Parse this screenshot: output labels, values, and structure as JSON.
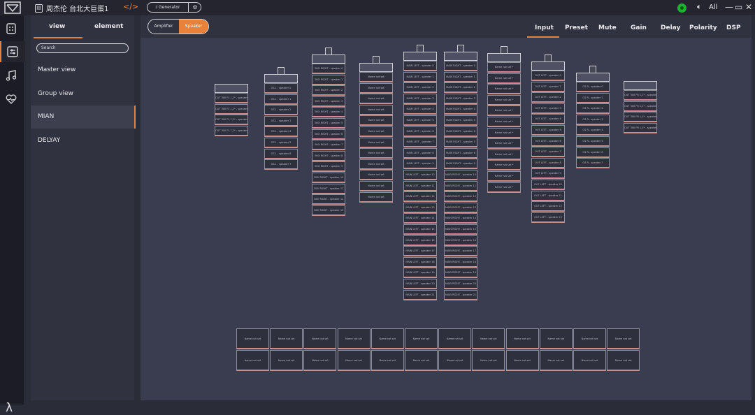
{
  "titlebar": {
    "project_title": "周杰伦 台北大巨蛋1",
    "project_icon": "save-icon",
    "nav_arrows": "</>",
    "generator_label": "Generator",
    "status_color": "#1fb32f",
    "volume_label": "All",
    "minimize": "—",
    "maximize": "▭",
    "close": "✕"
  },
  "rail": [
    "grid-icon",
    "mixer-icon",
    "music-icon",
    "heartbeat-icon"
  ],
  "sidebar": {
    "tabs": [
      "view",
      "element"
    ],
    "search_placeholder": "Search",
    "items": [
      "Master view",
      "Group view",
      "MIAN",
      "DELYAY"
    ],
    "selected": "MIAN"
  },
  "main": {
    "toggle": [
      "Amplifier",
      "Speaker"
    ],
    "active_toggle": "Speaker",
    "tabs": [
      "Input",
      "Preset",
      "Mute",
      "Gain",
      "Delay",
      "Polarity",
      "DSP"
    ],
    "active_tab": "Input",
    "columns": [
      {
        "cells": [
          "OUT 300 FL 1,1* - speaker",
          "OUT 300 FL 1,1* - speaker",
          "OUT 300 FL 1,1* - speaker",
          "OUT 300 FL 1,1* - speaker"
        ]
      },
      {
        "cells": [
          "OS L - speaker 0",
          "OS L - speaker 1",
          "OS L - speaker 2",
          "OS L - speaker 3",
          "OS L - speaker 4",
          "OS L - speaker 5",
          "OS L - speaker 6",
          "OS L - speaker 7"
        ]
      },
      {
        "cells": [
          "300I RIGHT - speaker 0",
          "300I RIGHT - speaker 1",
          "300I RIGHT - speaker 2",
          "300I RIGHT - speaker 3",
          "300I RIGHT - speaker 4",
          "300I RIGHT - speaker 5",
          "300I RIGHT - speaker 6",
          "300I RIGHT - speaker 7",
          "300I RIGHT - speaker 8",
          "300I RIGHT - speaker 9",
          "300I RIGHT - speaker 10",
          "300I RIGHT - speaker 11",
          "300I RIGHT - speaker 12",
          "300I RIGHT - speaker 13"
        ]
      },
      {
        "cells": [
          "Name not set",
          "Name not set",
          "Name not set",
          "Name not set",
          "Name not set",
          "Name not set",
          "Name not set",
          "Name not set",
          "Name not set",
          "Name not set",
          "Name not set",
          "Name not set"
        ]
      },
      {
        "cells": [
          "MAIN LEFT - speaker 0",
          "MAIN LEFT - speaker 1",
          "MAIN LEFT - speaker 2",
          "MAIN LEFT - speaker 3",
          "MAIN LEFT - speaker 4",
          "MAIN LEFT - speaker 5",
          "MAIN LEFT - speaker 6",
          "MAIN LEFT - speaker 7",
          "MAIN LEFT - speaker 8",
          "MAIN LEFT - speaker 9",
          "MAIN LEFT - speaker 10",
          "MAIN LEFT - speaker 11",
          "MAIN LEFT - speaker 12",
          "MAIN LEFT - speaker 13",
          "MAIN LEFT - speaker 14",
          "MAIN LEFT - speaker 15",
          "MAIN LEFT - speaker 16",
          "MAIN LEFT - speaker 17",
          "MAIN LEFT - speaker 18",
          "MAIN LEFT - speaker 19",
          "MAIN LEFT - speaker 20",
          "MAIN LEFT - speaker 21"
        ]
      },
      {
        "cells": [
          "MAIN RIGHT - speaker 0",
          "MAIN RIGHT - speaker 1",
          "MAIN RIGHT - speaker 2",
          "MAIN RIGHT - speaker 3",
          "MAIN RIGHT - speaker 4",
          "MAIN RIGHT - speaker 5",
          "MAIN RIGHT - speaker 6",
          "MAIN RIGHT - speaker 7",
          "MAIN RIGHT - speaker 8",
          "MAIN RIGHT - speaker 9",
          "MAIN RIGHT - speaker 10",
          "MAIN RIGHT - speaker 11",
          "MAIN RIGHT - speaker 12",
          "MAIN RIGHT - speaker 13",
          "MAIN RIGHT - speaker 14",
          "MAIN RIGHT - speaker 15",
          "MAIN RIGHT - speaker 16",
          "MAIN RIGHT - speaker 17",
          "MAIN RIGHT - speaker 18",
          "MAIN RIGHT - speaker 19",
          "MAIN RIGHT - speaker 20",
          "MAIN RIGHT - speaker 21"
        ]
      },
      {
        "cells": [
          "Name not set *",
          "Name not set *",
          "Name not set *",
          "Name not set *",
          "Name not set *",
          "Name not set *",
          "Name not set *",
          "Name not set *",
          "Name not set *",
          "Name not set *",
          "Name not set *",
          "Name not set *"
        ]
      },
      {
        "cells": [
          "OUT LEFT - speaker 0",
          "OUT LEFT - speaker 1",
          "OUT LEFT - speaker 2",
          "OUT LEFT - speaker 3",
          "OUT LEFT - speaker 4",
          "OUT LEFT - speaker 5",
          "OUT LEFT - speaker 6",
          "OUT LEFT - speaker 7",
          "OUT LEFT - speaker 8",
          "OUT LEFT - speaker 9",
          "OUT LEFT - speaker 10",
          "OUT LEFT - speaker 11",
          "OUT LEFT - speaker 12",
          "OUT LEFT - speaker 13"
        ]
      },
      {
        "cells": [
          "OS R - speaker 0",
          "OS R - speaker 1",
          "OS R - speaker 2",
          "OS R - speaker 3",
          "OS R - speaker 4",
          "OS R - speaker 5",
          "OS R - speaker 6",
          "OS R - speaker 7"
        ]
      },
      {
        "cells": [
          "OUT 300 FR 1,1* - speaker",
          "OUT 300 FR 1,1* - speaker",
          "OUT 300 FR 1,1* - speaker",
          "OUT 300 FR 1,1* - speaker"
        ]
      }
    ],
    "floor_cells": [
      "Name not set",
      "Name not set",
      "Name not set",
      "Name not set",
      "Name not set",
      "Name not set",
      "Name not set",
      "Name not set",
      "Name not set",
      "Name not set",
      "Name not set",
      "Name not set",
      "Name not set",
      "Name not set",
      "Name not set",
      "Name not set",
      "Name not set",
      "Name not set",
      "Name not set",
      "Name not set",
      "Name not set",
      "Name not set",
      "Name not set",
      "Name not set"
    ]
  }
}
